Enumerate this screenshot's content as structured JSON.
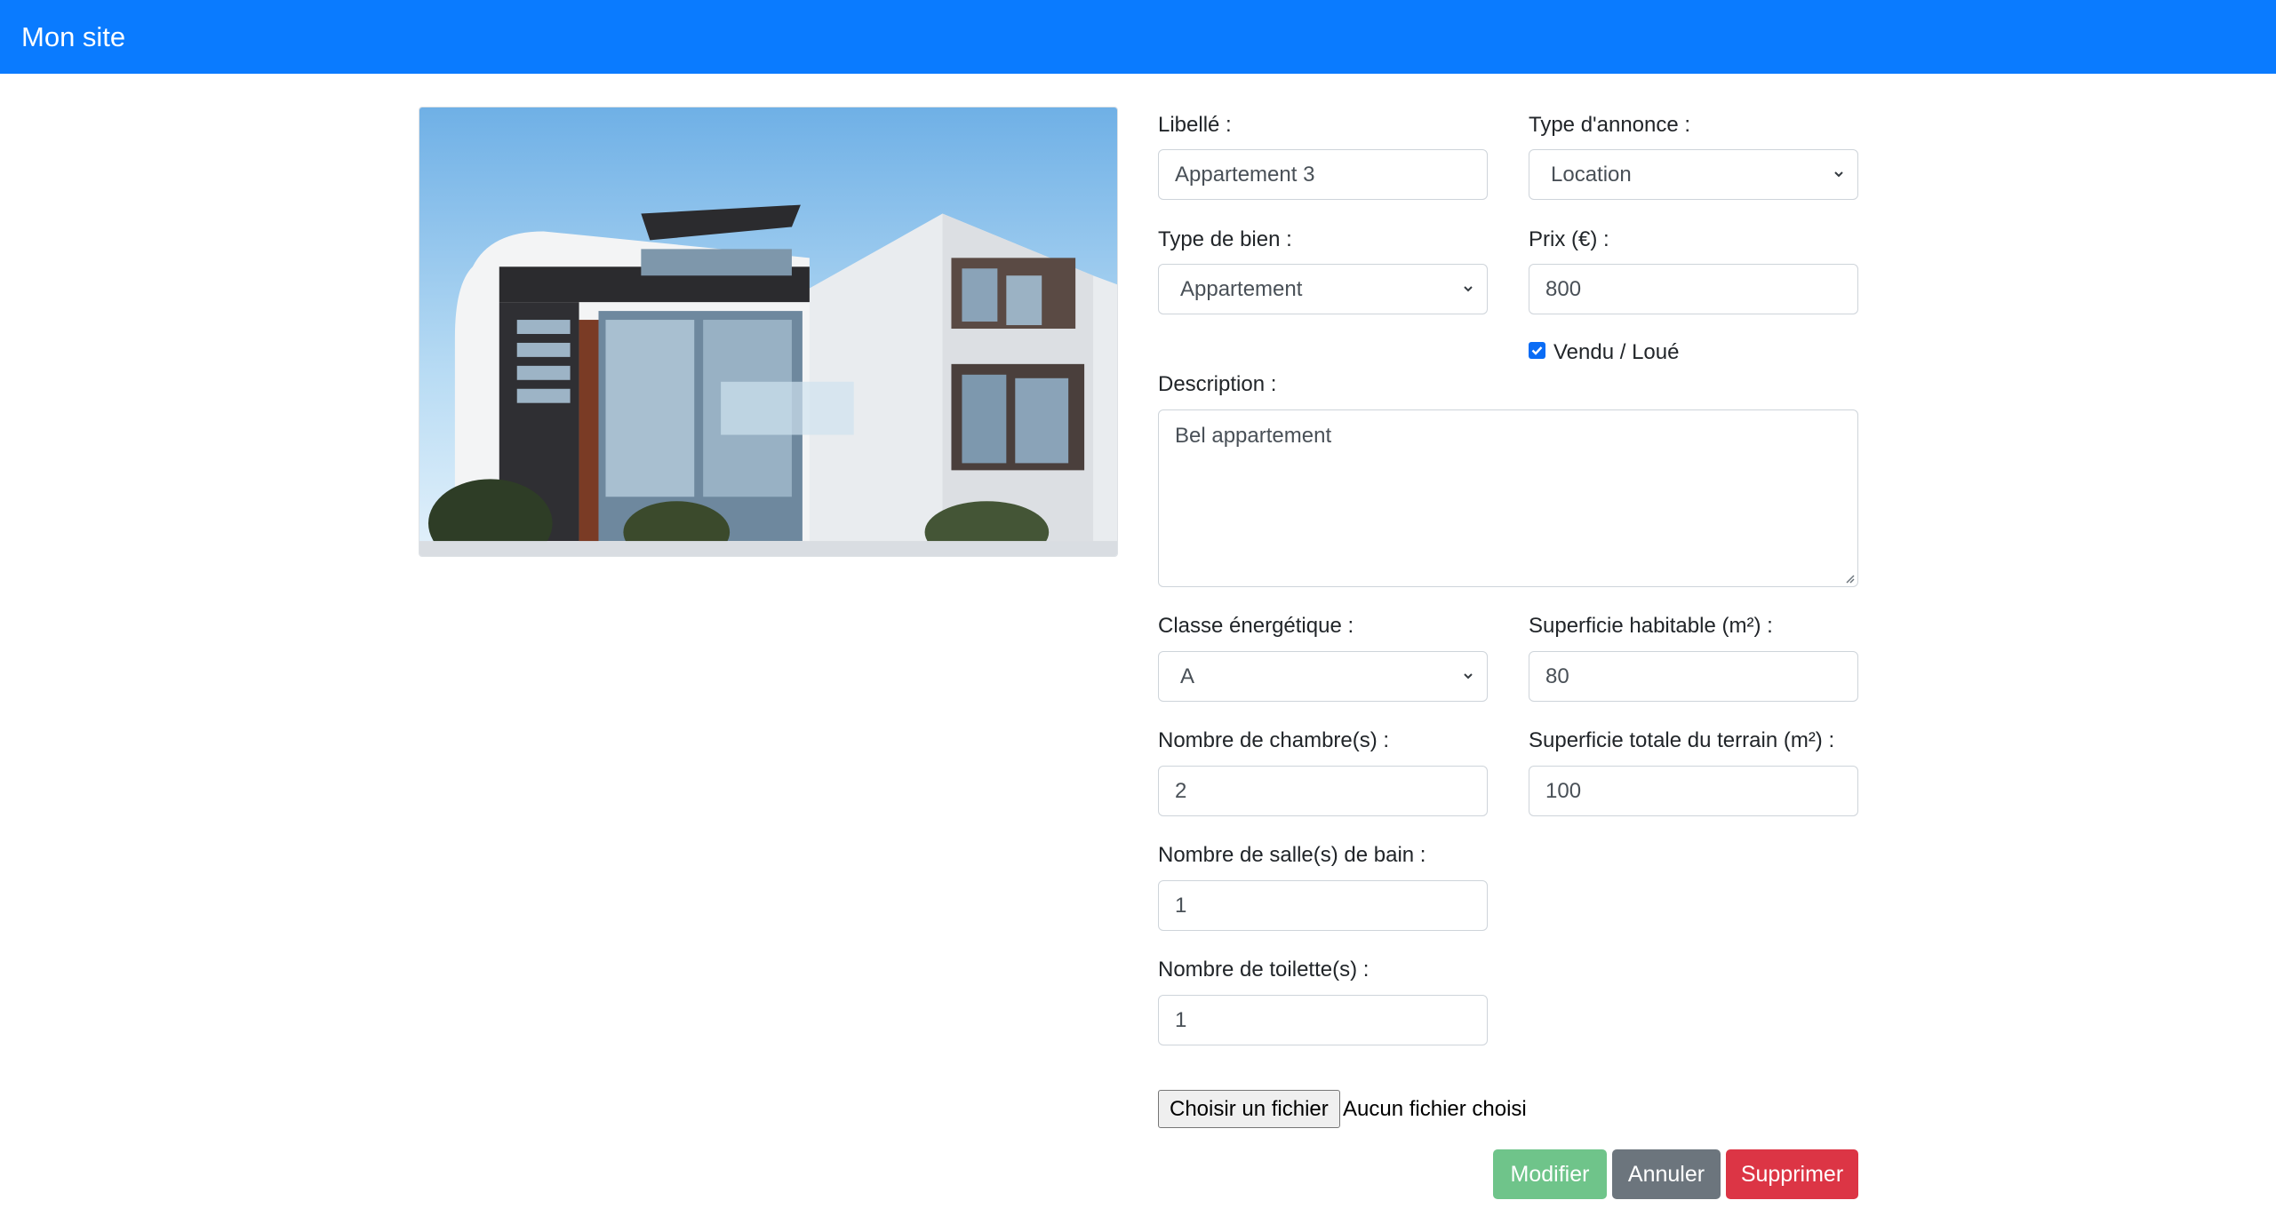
{
  "header": {
    "brand": "Mon site"
  },
  "photo": {
    "alt_icon": "building-photo"
  },
  "form": {
    "libelle": {
      "label": "Libellé :",
      "value": "Appartement 3"
    },
    "type_annonce": {
      "label": "Type d'annonce :",
      "selected": "Location"
    },
    "type_bien": {
      "label": "Type de bien :",
      "selected": "Appartement"
    },
    "prix": {
      "label": "Prix (€) :",
      "value": "800"
    },
    "vendu": {
      "label": "Vendu / Loué",
      "checked": true
    },
    "description": {
      "label": "Description :",
      "value": "Bel appartement"
    },
    "classe": {
      "label": "Classe énergétique :",
      "selected": "A"
    },
    "superficie_hab": {
      "label": "Superficie habitable (m²) :",
      "value": "80"
    },
    "chambres": {
      "label": "Nombre de chambre(s) :",
      "value": "2"
    },
    "superficie_terrain": {
      "label": "Superficie totale du terrain (m²) :",
      "value": "100"
    },
    "salles_bain": {
      "label": "Nombre de salle(s) de bain :",
      "value": "1"
    },
    "toilettes": {
      "label": "Nombre de toilette(s) :",
      "value": "1"
    },
    "file": {
      "button": "Choisir un fichier",
      "status": "Aucun fichier choisi"
    }
  },
  "actions": {
    "modifier": "Modifier",
    "annuler": "Annuler",
    "supprimer": "Supprimer"
  },
  "colors": {
    "navbar": "#0a7bff",
    "success_disabled": "#6fc48a",
    "secondary": "#6c757d",
    "danger": "#dc3545"
  }
}
